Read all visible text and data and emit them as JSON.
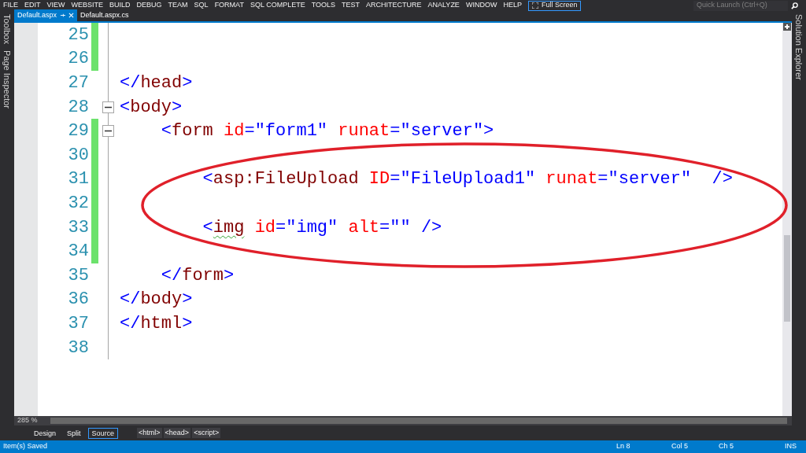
{
  "menu": [
    "FILE",
    "EDIT",
    "VIEW",
    "WEBSITE",
    "BUILD",
    "DEBUG",
    "TEAM",
    "SQL",
    "FORMAT",
    "SQL COMPLETE",
    "TOOLS",
    "TEST",
    "ARCHITECTURE",
    "ANALYZE",
    "WINDOW",
    "HELP"
  ],
  "full_screen": "Full Screen",
  "quick_launch": {
    "placeholder": "Quick Launch (Ctrl+Q)"
  },
  "tabs": [
    {
      "label": "Default.aspx",
      "selected": true
    },
    {
      "label": "Default.aspx.cs",
      "selected": false
    }
  ],
  "left_panels": [
    "Toolbox",
    "Page Inspector"
  ],
  "right_panels": [
    "Solution Explorer"
  ],
  "lines": [
    {
      "number": "25",
      "changed": true,
      "fold": false
    },
    {
      "number": "26",
      "changed": true,
      "fold": false
    },
    {
      "number": "27",
      "changed": false,
      "fold": false,
      "tokens": [
        {
          "kind": "punct",
          "text": "</"
        },
        {
          "kind": "tag",
          "text": "head"
        },
        {
          "kind": "punct",
          "text": ">"
        }
      ]
    },
    {
      "number": "28",
      "changed": false,
      "fold": true,
      "tokens": [
        {
          "kind": "punct",
          "text": "<"
        },
        {
          "kind": "tag",
          "text": "body"
        },
        {
          "kind": "punct",
          "text": ">"
        }
      ]
    },
    {
      "number": "29",
      "changed": true,
      "fold": true,
      "tokens": [
        {
          "kind": "punct",
          "text": "    <"
        },
        {
          "kind": "tag",
          "text": "form"
        },
        {
          "kind": "attr",
          "text": " id"
        },
        {
          "kind": "punct",
          "text": "="
        },
        {
          "kind": "value",
          "text": "\"form1\""
        },
        {
          "kind": "attr",
          "text": " runat"
        },
        {
          "kind": "punct",
          "text": "="
        },
        {
          "kind": "value",
          "text": "\"server\""
        },
        {
          "kind": "punct",
          "text": ">"
        }
      ]
    },
    {
      "number": "30",
      "changed": true,
      "fold": false
    },
    {
      "number": "31",
      "changed": true,
      "fold": false,
      "tokens": [
        {
          "kind": "punct",
          "text": "        <"
        },
        {
          "kind": "tag",
          "text": "asp:FileUpload"
        },
        {
          "kind": "attr",
          "text": " ID"
        },
        {
          "kind": "punct",
          "text": "="
        },
        {
          "kind": "value",
          "text": "\"FileUpload1\""
        },
        {
          "kind": "attr",
          "text": " runat"
        },
        {
          "kind": "punct",
          "text": "="
        },
        {
          "kind": "value",
          "text": "\"server\""
        },
        {
          "kind": "punct",
          "text": "  />"
        }
      ]
    },
    {
      "number": "32",
      "changed": true,
      "fold": false
    },
    {
      "number": "33",
      "changed": true,
      "fold": false,
      "tokens": [
        {
          "kind": "punct",
          "text": "        <"
        },
        {
          "kind": "tag",
          "text": "img",
          "squiggle": true
        },
        {
          "kind": "attr",
          "text": " id"
        },
        {
          "kind": "punct",
          "text": "="
        },
        {
          "kind": "value",
          "text": "\"img\""
        },
        {
          "kind": "attr",
          "text": " alt"
        },
        {
          "kind": "punct",
          "text": "="
        },
        {
          "kind": "value",
          "text": "\"\""
        },
        {
          "kind": "punct",
          "text": " />"
        }
      ]
    },
    {
      "number": "34",
      "changed": true,
      "fold": false
    },
    {
      "number": "35",
      "changed": false,
      "fold": false,
      "tokens": [
        {
          "kind": "punct",
          "text": "    </"
        },
        {
          "kind": "tag",
          "text": "form"
        },
        {
          "kind": "punct",
          "text": ">"
        }
      ]
    },
    {
      "number": "36",
      "changed": false,
      "fold": false,
      "tokens": [
        {
          "kind": "punct",
          "text": "</"
        },
        {
          "kind": "tag",
          "text": "body"
        },
        {
          "kind": "punct",
          "text": ">"
        }
      ]
    },
    {
      "number": "37",
      "changed": false,
      "fold": false,
      "tokens": [
        {
          "kind": "punct",
          "text": "</"
        },
        {
          "kind": "tag",
          "text": "html"
        },
        {
          "kind": "punct",
          "text": ">"
        }
      ]
    },
    {
      "number": "38",
      "changed": false,
      "fold": false
    }
  ],
  "zoom": "285 %",
  "views": [
    {
      "label": "Design",
      "selected": false
    },
    {
      "label": "Split",
      "selected": false
    },
    {
      "label": "Source",
      "selected": true
    }
  ],
  "breadcrumbs": [
    "<html>",
    "<head>",
    "<script>"
  ],
  "status": {
    "message": "Item(s) Saved",
    "ln": "Ln 8",
    "col": "Col 5",
    "ch": "Ch 5",
    "mode": "INS"
  }
}
